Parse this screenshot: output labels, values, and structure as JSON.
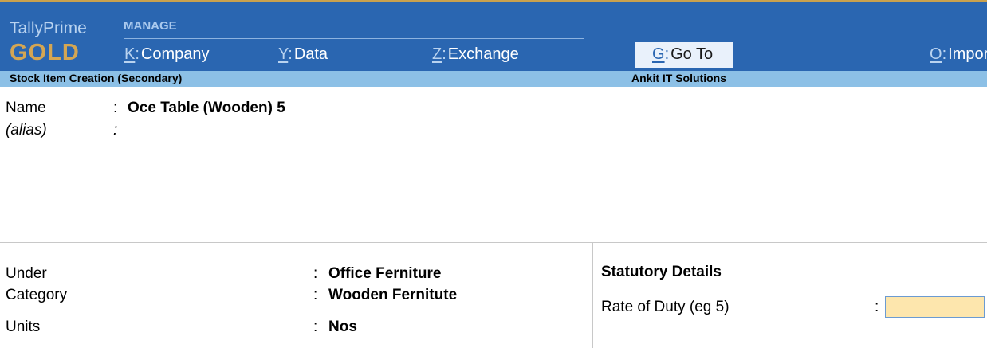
{
  "brand": {
    "product": "TallyPrime",
    "edition": "GOLD"
  },
  "menu": {
    "heading": "MANAGE",
    "items": [
      {
        "key": "K",
        "label": "Company"
      },
      {
        "key": "Y",
        "label": "Data"
      },
      {
        "key": "Z",
        "label": "Exchange"
      },
      {
        "key": "G",
        "label": "Go To"
      },
      {
        "key": "O",
        "label": "Impor"
      }
    ]
  },
  "infobar": {
    "screen_title": "Stock Item Creation (Secondary)",
    "company": "Ankit IT Solutions"
  },
  "form": {
    "name": {
      "label": "Name",
      "value": "Oce Table (Wooden) 5"
    },
    "alias": {
      "label": "(alias)",
      "value": ""
    },
    "under": {
      "label": "Under",
      "value": "Office Ferniture"
    },
    "category": {
      "label": "Category",
      "value": "Wooden Fernitute"
    },
    "units": {
      "label": "Units",
      "value": "Nos"
    },
    "colon": ":"
  },
  "statutory": {
    "title": "Statutory Details",
    "rate_of_duty": {
      "label": "Rate of Duty (eg 5)",
      "value": ""
    }
  },
  "colors": {
    "topbar": "#2a66b1",
    "infobar": "#8cc0e6",
    "edition": "#d4a653",
    "active_input": "#fde6ad"
  }
}
